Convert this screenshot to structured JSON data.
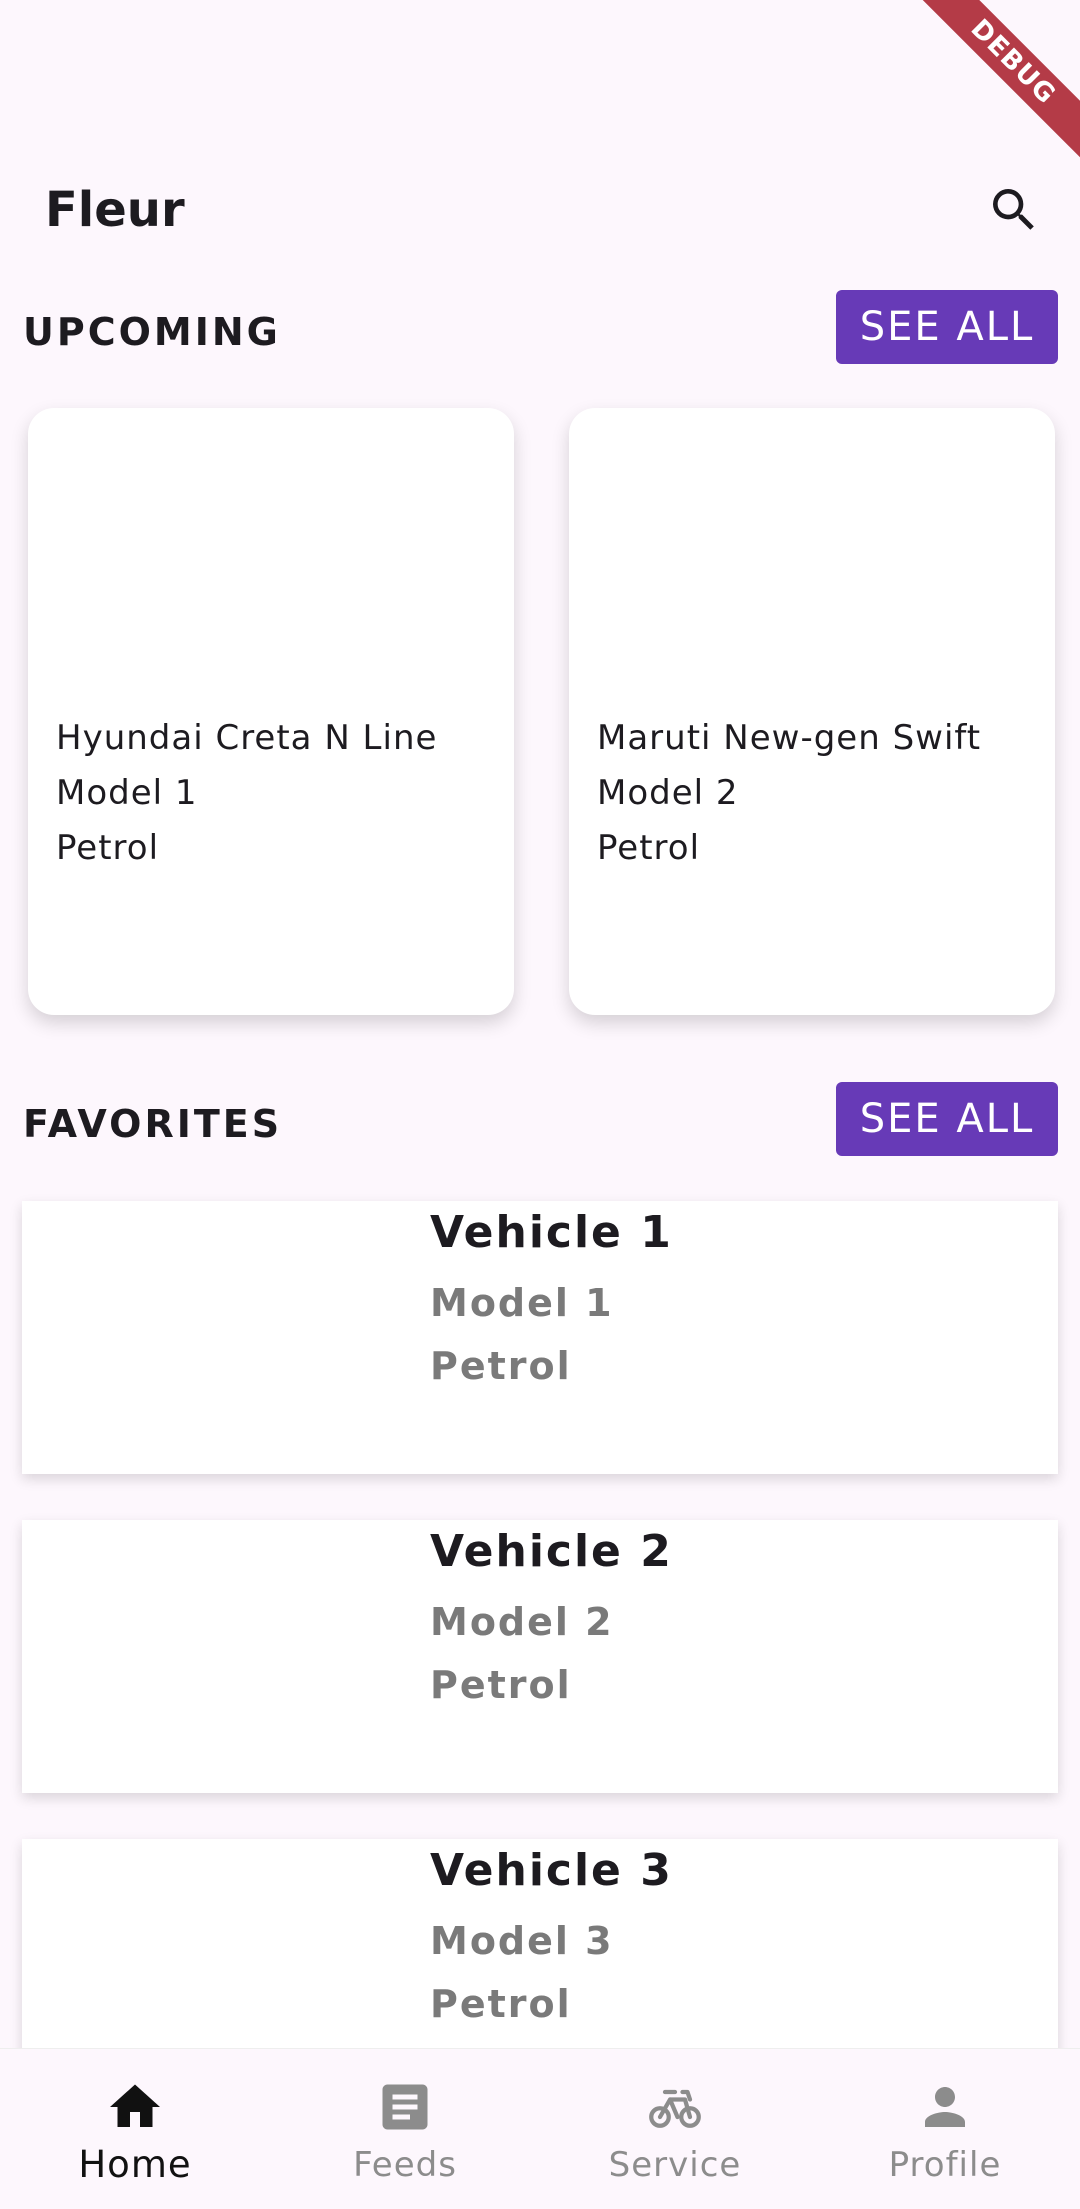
{
  "debug_banner": "DEBUG",
  "app_bar": {
    "title": "Fleur",
    "search_icon": "search-icon"
  },
  "upcoming": {
    "title": "UPCOMING",
    "see_all_label": "SEE ALL",
    "cards": [
      {
        "name": "Hyundai Creta N Line",
        "model": "Model 1",
        "fuel": "Petrol"
      },
      {
        "name": "Maruti New-gen Swift",
        "model": "Model 2",
        "fuel": "Petrol"
      }
    ]
  },
  "favorites": {
    "title": "FAVORITES",
    "see_all_label": "SEE ALL",
    "items": [
      {
        "name": "Vehicle 1",
        "model": "Model 1",
        "fuel": "Petrol"
      },
      {
        "name": "Vehicle 2",
        "model": "Model 2",
        "fuel": "Petrol"
      },
      {
        "name": "Vehicle 3",
        "model": "Model 3",
        "fuel": "Petrol"
      }
    ]
  },
  "bottom_nav": {
    "items": [
      {
        "label": "Home",
        "icon": "home-icon",
        "active": true
      },
      {
        "label": "Feeds",
        "icon": "article-icon",
        "active": false
      },
      {
        "label": "Service",
        "icon": "pedal-bike-icon",
        "active": false
      },
      {
        "label": "Profile",
        "icon": "person-icon",
        "active": false
      }
    ]
  },
  "colors": {
    "accent": "#673ab7",
    "background": "#fdf7fd",
    "debug_ribbon": "#b43b47"
  }
}
